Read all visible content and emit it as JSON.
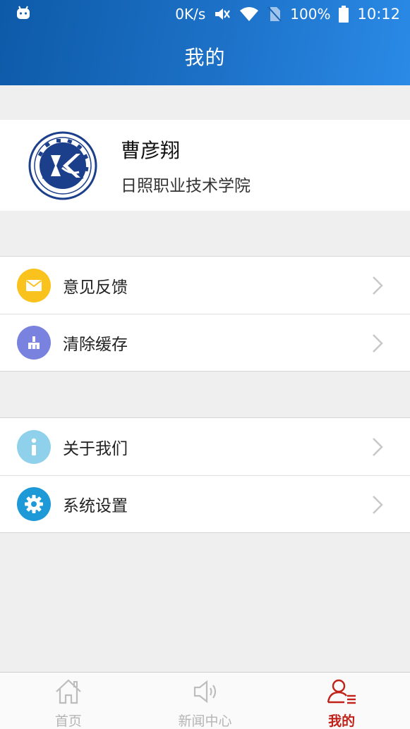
{
  "status_bar": {
    "speed": "0K/s",
    "battery": "100%",
    "time": "10:12"
  },
  "header": {
    "title": "我的"
  },
  "profile": {
    "name": "曹彦翔",
    "school": "日照职业技术学院"
  },
  "menu_groups": [
    [
      {
        "label": "意见反馈",
        "icon": "mail-icon",
        "color": "#f9c21c"
      },
      {
        "label": "清除缓存",
        "icon": "broom-icon",
        "color": "#7a82e0"
      }
    ],
    [
      {
        "label": "关于我们",
        "icon": "info-icon",
        "color": "#8fd0ea"
      },
      {
        "label": "系统设置",
        "icon": "gear-icon",
        "color": "#1d99d8"
      }
    ]
  ],
  "bottom_nav": {
    "tabs": [
      {
        "label": "首页",
        "icon": "home-icon",
        "active": false
      },
      {
        "label": "新闻中心",
        "icon": "speaker-icon",
        "active": false
      },
      {
        "label": "我的",
        "icon": "user-icon",
        "active": true
      }
    ]
  },
  "colors": {
    "header_start": "#0d5aa8",
    "header_end": "#2a8ae6",
    "active_tab": "#c0221a",
    "inactive_tab": "#b5b5b5",
    "background": "#efefef"
  }
}
